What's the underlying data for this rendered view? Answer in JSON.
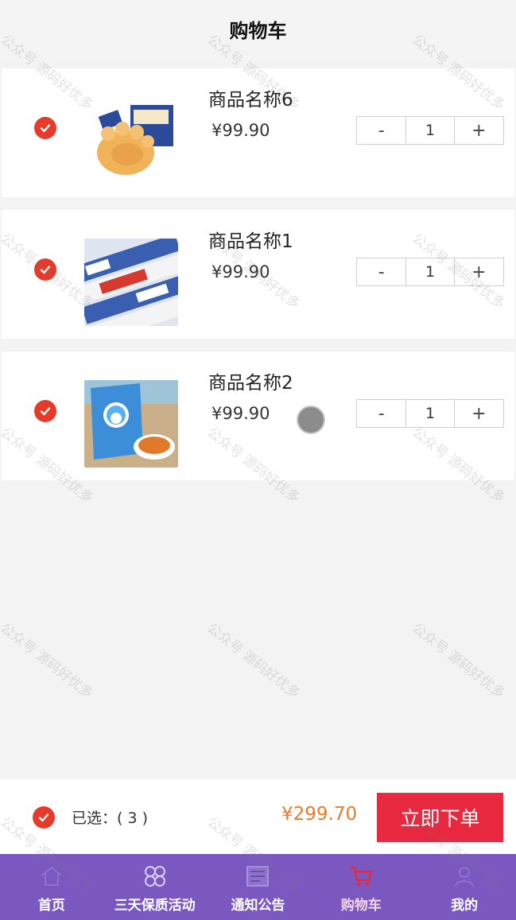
{
  "header": {
    "title": "购物车"
  },
  "currency": "¥",
  "items": [
    {
      "name": "商品名称6",
      "price": "¥99.90",
      "qty": "1",
      "minus": "-",
      "plus": "+"
    },
    {
      "name": "商品名称1",
      "price": "¥99.90",
      "qty": "1",
      "minus": "-",
      "plus": "+"
    },
    {
      "name": "商品名称2",
      "price": "¥99.90",
      "qty": "1",
      "minus": "-",
      "plus": "+"
    }
  ],
  "summary": {
    "selected_label": "已选：( 3 )",
    "total": "¥299.70",
    "order_button": "立即下单"
  },
  "tabs": [
    {
      "label": "首页",
      "icon": "home-icon"
    },
    {
      "label": "三天保质活动",
      "icon": "clover-icon"
    },
    {
      "label": "通知公告",
      "icon": "news-icon"
    },
    {
      "label": "购物车",
      "icon": "cart-icon",
      "active": true
    },
    {
      "label": "我的",
      "icon": "user-icon"
    }
  ],
  "watermark": "公众号 源码好优多",
  "colors": {
    "accent_red": "#e63a2a",
    "order_button": "#e8283e",
    "total_price": "#ec7a2a",
    "tabbar": "#7a58c0"
  }
}
